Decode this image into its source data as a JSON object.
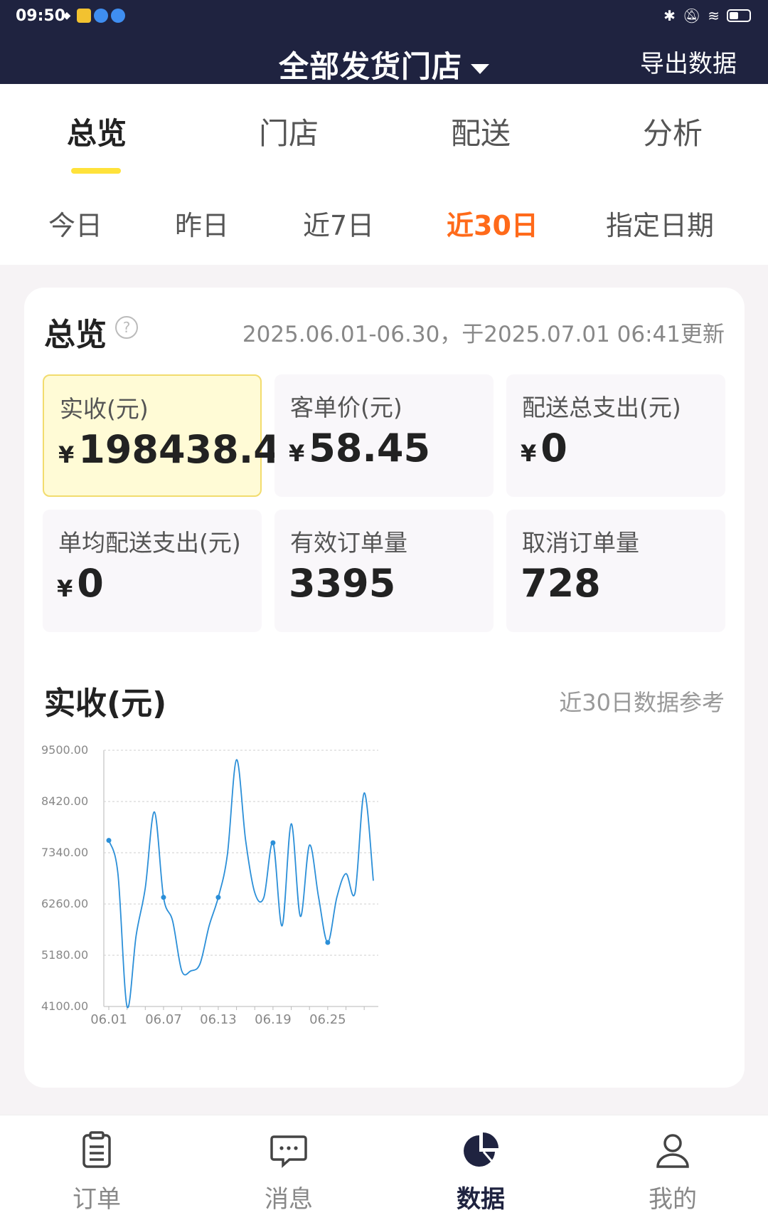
{
  "status_bar": {
    "time": "09:50"
  },
  "header": {
    "title": "全部发货门店",
    "export_label": "导出数据"
  },
  "tabs": [
    {
      "label": "总览",
      "active": true
    },
    {
      "label": "门店",
      "active": false
    },
    {
      "label": "配送",
      "active": false
    },
    {
      "label": "分析",
      "active": false
    }
  ],
  "date_filters": [
    {
      "label": "今日",
      "active": false
    },
    {
      "label": "昨日",
      "active": false
    },
    {
      "label": "近7日",
      "active": false
    },
    {
      "label": "近30日",
      "active": true
    },
    {
      "label": "指定日期",
      "active": false
    }
  ],
  "overview": {
    "title": "总览",
    "help_icon": "question-icon",
    "date_range": "2025.06.01-06.30，于2025.07.01 06:41更新"
  },
  "metrics": [
    {
      "label": "实收(元)",
      "currency": "¥",
      "value": "198438.4",
      "highlight": true
    },
    {
      "label": "客单价(元)",
      "currency": "¥",
      "value": "58.45",
      "highlight": false
    },
    {
      "label": "配送总支出(元)",
      "currency": "¥",
      "value": "0",
      "highlight": false
    },
    {
      "label": "单均配送支出(元)",
      "currency": "¥",
      "value": "0",
      "highlight": false
    },
    {
      "label": "有效订单量",
      "currency": "",
      "value": "3395",
      "highlight": false
    },
    {
      "label": "取消订单量",
      "currency": "",
      "value": "728",
      "highlight": false
    }
  ],
  "chart_section": {
    "title": "实收(元)",
    "note": "近30日数据参考"
  },
  "chart_data": {
    "type": "line",
    "title": "实收(元)",
    "xlabel": "",
    "ylabel": "",
    "ylim": [
      4100,
      9500
    ],
    "y_ticks": [
      "9500.00",
      "8420.00",
      "7340.00",
      "6260.00",
      "5180.00",
      "4100.00"
    ],
    "x_tick_labels": [
      "06.01",
      "06.07",
      "06.13",
      "06.19",
      "06.25"
    ],
    "x": [
      "06.01",
      "06.02",
      "06.03",
      "06.04",
      "06.05",
      "06.06",
      "06.07",
      "06.08",
      "06.09",
      "06.10",
      "06.11",
      "06.12",
      "06.13",
      "06.14",
      "06.15",
      "06.16",
      "06.17",
      "06.18",
      "06.19",
      "06.20",
      "06.21",
      "06.22",
      "06.23",
      "06.24",
      "06.25",
      "06.26",
      "06.27",
      "06.28",
      "06.29",
      "06.30"
    ],
    "values": [
      7600,
      6900,
      4100,
      5600,
      6600,
      8200,
      6400,
      5900,
      4850,
      4850,
      5000,
      5800,
      6400,
      7300,
      9300,
      7600,
      6500,
      6400,
      7550,
      5800,
      7950,
      6000,
      7500,
      6400,
      5450,
      6400,
      6900,
      6500,
      8600,
      6750
    ],
    "markers": [
      0,
      6,
      12,
      18,
      24
    ],
    "series_color": "#2b8fd8",
    "grid": true
  },
  "bottom_nav": [
    {
      "label": "订单",
      "icon": "clipboard-list-icon",
      "active": false
    },
    {
      "label": "消息",
      "icon": "chat-bubble-icon",
      "active": false
    },
    {
      "label": "数据",
      "icon": "pie-chart-icon",
      "active": true
    },
    {
      "label": "我的",
      "icon": "user-icon",
      "active": false
    }
  ]
}
